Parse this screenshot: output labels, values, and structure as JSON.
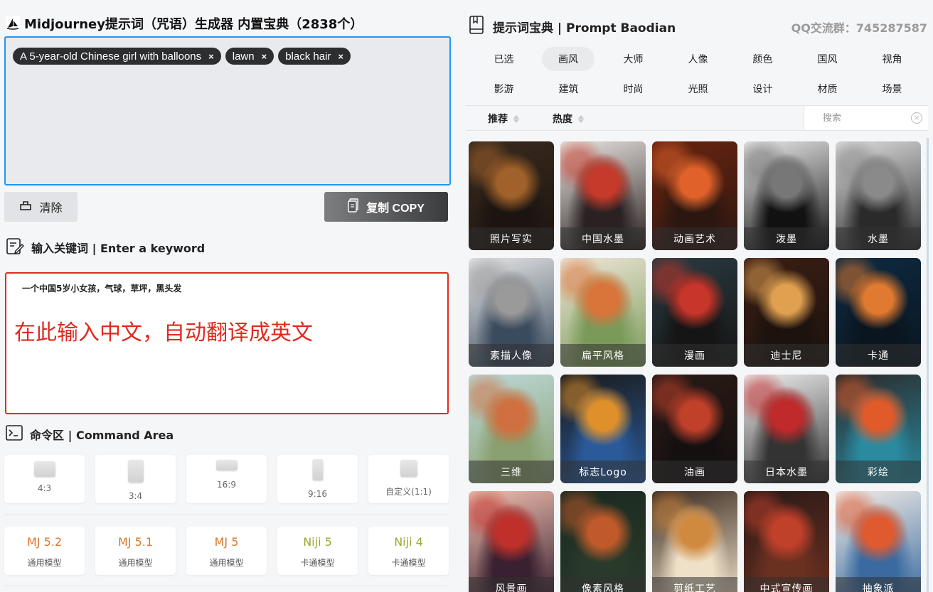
{
  "app": {
    "title": "Midjourney提示词（咒语）生成器 内置宝典（2838个）"
  },
  "prompt_tags": [
    {
      "text": "A 5-year-old Chinese girl with balloons",
      "remove": "×"
    },
    {
      "text": "lawn",
      "remove": "×"
    },
    {
      "text": "black hair",
      "remove": "×"
    }
  ],
  "actions": {
    "clear_label": "清除",
    "copy_label": "复制 COPY"
  },
  "keyword": {
    "heading": "输入关键词 | Enter a keyword",
    "value": "一个中国5岁小女孩，气球，草坪，黑头发",
    "hint": "在此输入中文，自动翻译成英文"
  },
  "command": {
    "heading": "命令区 | Command Area",
    "ratios": [
      {
        "label": "4:3"
      },
      {
        "label": "3:4"
      },
      {
        "label": "16:9"
      },
      {
        "label": "9:16"
      },
      {
        "label": "自定义(1:1)"
      }
    ],
    "models": [
      {
        "name": "MJ 5.2",
        "sub": "通用模型",
        "color": "#d9772b"
      },
      {
        "name": "MJ 5.1",
        "sub": "通用模型",
        "color": "#d9772b"
      },
      {
        "name": "MJ 5",
        "sub": "通用模型",
        "color": "#d9772b"
      },
      {
        "name": "Niji 5",
        "sub": "卡通模型",
        "color": "#9aa832"
      },
      {
        "name": "Niji 4",
        "sub": "卡通模型",
        "color": "#9aa832"
      }
    ]
  },
  "baodian": {
    "title": "提示词宝典 | Prompt Baodian",
    "qq": "QQ交流群：745287587",
    "categories": [
      "已选",
      "画风",
      "大师",
      "人像",
      "颜色",
      "国风",
      "视角",
      "影游",
      "建筑",
      "时尚",
      "光照",
      "设计",
      "材质",
      "场景"
    ],
    "active_category": "画风",
    "sort": {
      "recommend": "推荐",
      "hot": "热度"
    },
    "search": {
      "placeholder": "搜索",
      "clear": "×"
    },
    "styles": [
      {
        "label": "照片写实",
        "colors": [
          "#3a2a1e",
          "#a0612a",
          "#1b1410"
        ]
      },
      {
        "label": "中国水墨",
        "colors": [
          "#e8e4e0",
          "#c53a2a",
          "#2a2222"
        ]
      },
      {
        "label": "动画艺术",
        "colors": [
          "#6a2410",
          "#e0622a",
          "#2b1710"
        ]
      },
      {
        "label": "泼墨",
        "colors": [
          "#e8e8e8",
          "#777777",
          "#111111"
        ]
      },
      {
        "label": "水墨",
        "colors": [
          "#dedede",
          "#8a8a8a",
          "#2a2a2a"
        ]
      },
      {
        "label": "素描人像",
        "colors": [
          "#e6e6e6",
          "#9a9a9a",
          "#3b4b5e"
        ]
      },
      {
        "label": "扁平风格",
        "colors": [
          "#efe6d8",
          "#d9743a",
          "#7a9a5a"
        ]
      },
      {
        "label": "漫画",
        "colors": [
          "#2a3a40",
          "#c8352a",
          "#151515"
        ]
      },
      {
        "label": "迪士尼",
        "colors": [
          "#3a1e14",
          "#e0a050",
          "#1c120e"
        ]
      },
      {
        "label": "卡通",
        "colors": [
          "#0e2a40",
          "#e07a30",
          "#0a1520"
        ]
      },
      {
        "label": "三维",
        "colors": [
          "#bcd8d8",
          "#d07040",
          "#8aa070"
        ]
      },
      {
        "label": "标志Logo",
        "colors": [
          "#1a1a1a",
          "#e0902a",
          "#2a5a9a"
        ]
      },
      {
        "label": "油画",
        "colors": [
          "#2a1a16",
          "#c0402a",
          "#141010"
        ]
      },
      {
        "label": "日本水墨",
        "colors": [
          "#eeeeee",
          "#c02a2a",
          "#333333"
        ]
      },
      {
        "label": "彩绘",
        "colors": [
          "#2a2a2a",
          "#e05a2a",
          "#2a8aa0"
        ]
      },
      {
        "label": "风景画",
        "colors": [
          "#f0c0b0",
          "#c0302a",
          "#3a2030"
        ]
      },
      {
        "label": "像素风格",
        "colors": [
          "#1a2a20",
          "#c05a2a",
          "#2a3a2a"
        ]
      },
      {
        "label": "剪纸工艺",
        "colors": [
          "#3a2a20",
          "#d08a40",
          "#efe0c8"
        ]
      },
      {
        "label": "中式宣传画",
        "colors": [
          "#2a1a18",
          "#c0402a",
          "#6a3020"
        ]
      },
      {
        "label": "抽象派",
        "colors": [
          "#f2ede6",
          "#e05a30",
          "#3a6aa0"
        ]
      }
    ]
  }
}
